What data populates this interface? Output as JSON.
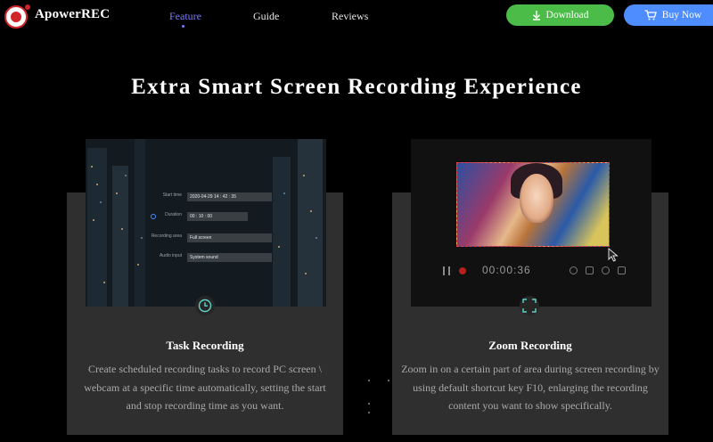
{
  "brand": {
    "name": "ApowerREC",
    "logo_icon": "record-logo-icon",
    "brand_color": "#d0262a"
  },
  "nav": {
    "items": [
      {
        "label": "Feature",
        "active": true
      },
      {
        "label": "Guide",
        "active": false
      },
      {
        "label": "Reviews",
        "active": false
      }
    ],
    "active_color": "#7b7bff"
  },
  "actions": {
    "download": {
      "label": "Download",
      "icon": "download-arrow-icon",
      "color": "#4cbc48"
    },
    "buy": {
      "label": "Buy Now",
      "icon": "cart-icon",
      "color": "#4d8dff"
    }
  },
  "section": {
    "title": "Extra Smart Screen Recording Experience"
  },
  "cards": [
    {
      "icon": "clock-icon",
      "title": "Task Recording",
      "description": "Create scheduled recording tasks to record PC screen \\ webcam at a specific time automatically, setting the start and stop recording time as you want.",
      "screenshot": {
        "rows": [
          {
            "label": "Start time",
            "value": "2020-04-29  14 : 42 : 35"
          },
          {
            "label": "Duration",
            "value": "00 : 10 : 00"
          },
          {
            "label": "Recording area",
            "value": "Full screen"
          },
          {
            "label": "Audio input",
            "value": "System sound"
          }
        ]
      }
    },
    {
      "icon": "zoom-frame-icon",
      "title": "Zoom Recording",
      "description": "Zoom in on a certain part of area during screen recording by using default shortcut key F10, enlarging the recording content you want to show specifically.",
      "screenshot": {
        "timer": "00:00:36"
      }
    }
  ]
}
